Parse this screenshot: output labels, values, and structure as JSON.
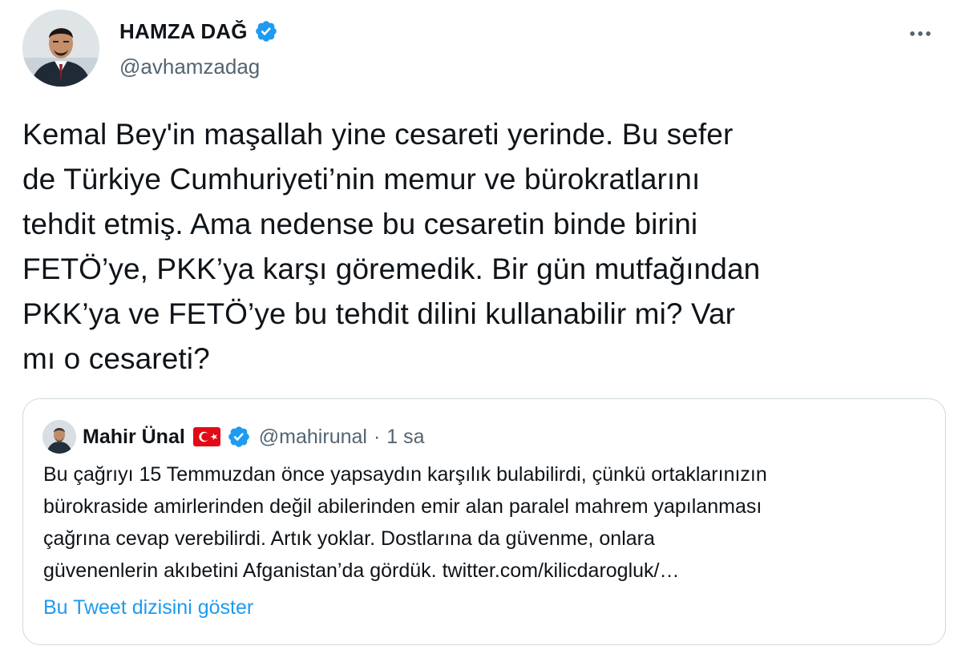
{
  "author": {
    "name": "HAMZA DAĞ",
    "handle": "@avhamzadag",
    "verified": true
  },
  "tweet": {
    "text": "Kemal Bey'in maşallah yine cesareti yerinde. Bu sefer\nde Türkiye Cumhuriyeti’nin memur ve bürokratlarını\ntehdit etmiş. Ama nedense bu cesaretin binde birini\nFETÖ’ye, PKK’ya karşı göremedik. Bir gün mutfağından\nPKK’ya ve FETÖ’ye bu tehdit dilini kullanabilir mi? Var\nmı o cesareti?"
  },
  "quoted_tweet": {
    "author_name": "Mahir Ünal",
    "handle": "@mahirunal",
    "separator": "·",
    "time": "1 sa",
    "flag": "turkey-flag-icon",
    "verified": true,
    "text": "Bu çağrıyı 15 Temmuzdan önce yapsaydın karşılık bulabilirdi, çünkü ortaklarınızın\nbürokraside amirlerinden değil abilerinden emir alan paralel mahrem yapılanması\nçağrına cevap verebilirdi. Artık yoklar. Dostlarına da güvenme, onlara\ngüvenenlerin akıbetini Afganistan’da gördük. twitter.com/kilicdarogluk/…",
    "show_thread_label": "Bu Tweet dizisini göster"
  },
  "colors": {
    "text_primary": "#0f1419",
    "text_secondary": "#536471",
    "link": "#1d9bf0",
    "verified_badge": "#1d9bf0",
    "border": "#cfd9de",
    "flag_red": "#e30a17"
  },
  "icons": {
    "verified": "verified-badge-icon",
    "more": "more-options-icon"
  }
}
